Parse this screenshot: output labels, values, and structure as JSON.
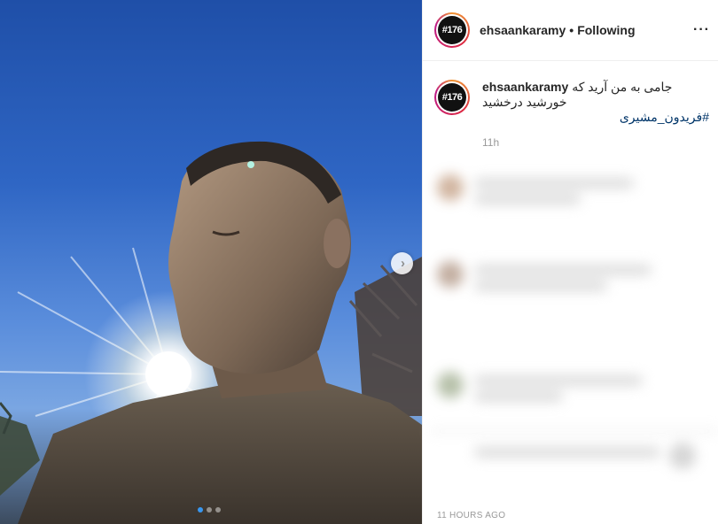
{
  "post": {
    "username": "ehsaankaramy",
    "separator": "•",
    "follow_status": "Following",
    "avatar_text": "#176",
    "more_icon": "more-horizontal-icon"
  },
  "caption": {
    "username": "ehsaankaramy",
    "text": "جامی به من آرید که خورشید درخشید",
    "hashtag": "#فریدون_مشیری",
    "time": "11h"
  },
  "footer": {
    "timestamp": "11 HOURS AGO"
  },
  "carousel": {
    "active_index": 0,
    "count": 3,
    "next_icon": "chevron-right-icon"
  },
  "colors": {
    "sky": "#2f66c4",
    "accent": "#3897f0",
    "hashtag": "#003569"
  }
}
